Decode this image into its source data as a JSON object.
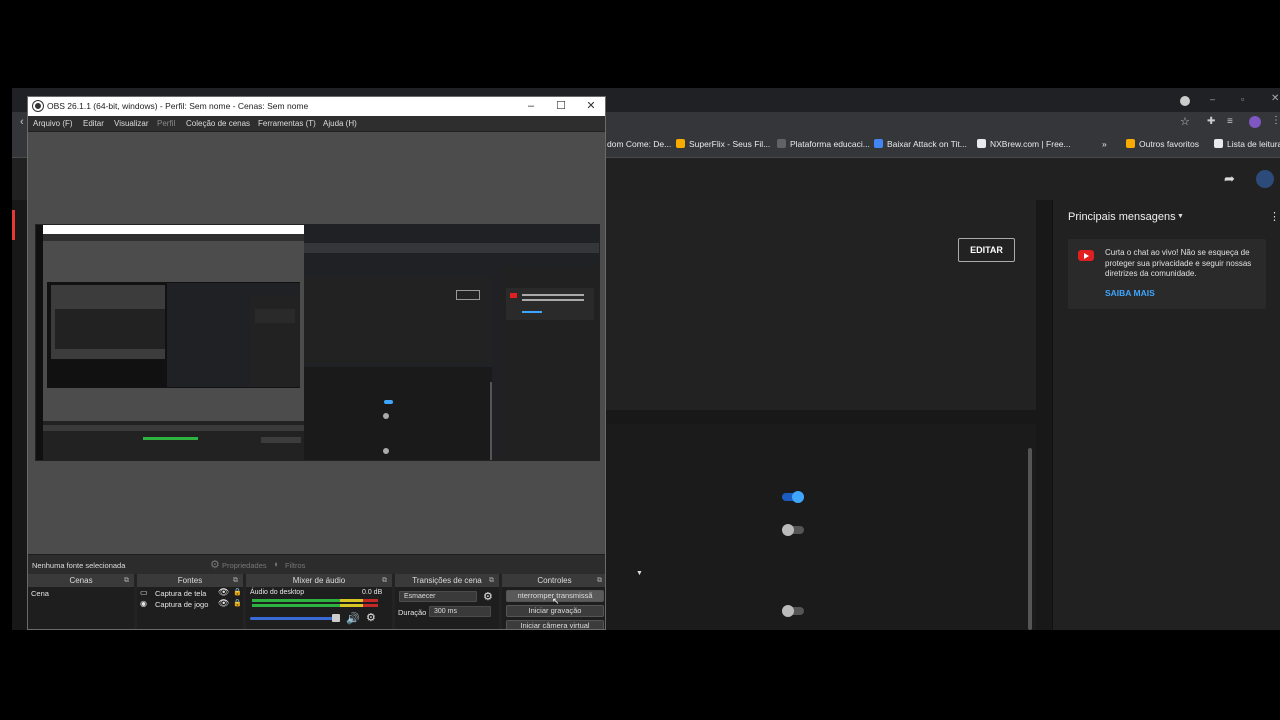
{
  "chrome": {
    "bookmarks": [
      {
        "label": "dom Come: De...",
        "color": "#9aa0a6"
      },
      {
        "label": "SuperFlix - Seus Fil...",
        "color": "#f9ab00"
      },
      {
        "label": "Plataforma educaci...",
        "color": "#5f6368"
      },
      {
        "label": "Baixar Attack on Tit...",
        "color": "#4285f4"
      },
      {
        "label": "NXBrew.com | Free...",
        "color": "#e8eaed"
      },
      {
        "label": "»",
        "color": ""
      },
      {
        "label": "Outros favoritos",
        "color": "#f9ab00"
      },
      {
        "label": "Lista de leitura",
        "color": "#e8eaed"
      }
    ]
  },
  "youtube": {
    "edit_button": "EDITAR",
    "chat_title": "Principais mensagens",
    "chat_message": "Curta o chat ao vivo! Não se esqueça de proteger sua privacidade e seguir nossas diretrizes da comunidade.",
    "chat_link": "SAIBA MAIS",
    "accent": "#3ea6ff"
  },
  "obs": {
    "title": "OBS 26.1.1 (64-bit, windows) - Perfil: Sem nome - Cenas: Sem nome",
    "menu": [
      "Arquivo (F)",
      "Editar",
      "Visualizar",
      "Perfil",
      "Coleção de cenas",
      "Ferramentas (T)",
      "Ajuda (H)"
    ],
    "source_bar": {
      "status": "Nenhuma fonte selecionada",
      "properties": "Propriedades",
      "filters": "Filtros"
    },
    "docks": {
      "scenes": {
        "title": "Cenas",
        "items": [
          "Cena"
        ]
      },
      "sources": {
        "title": "Fontes",
        "items": [
          "Captura de tela",
          "Captura de jogo"
        ]
      },
      "mixer": {
        "title": "Mixer de áudio",
        "channel": "Áudio do desktop",
        "level": "0.0 dB"
      },
      "transitions": {
        "title": "Transições de cena",
        "type": "Esmaecer",
        "duration_label": "Duração",
        "duration": "300 ms"
      },
      "controls": {
        "title": "Controles",
        "buttons": [
          "nterromper transmissã",
          "Iniciar gravação",
          "Iniciar câmera virtual"
        ]
      }
    }
  }
}
